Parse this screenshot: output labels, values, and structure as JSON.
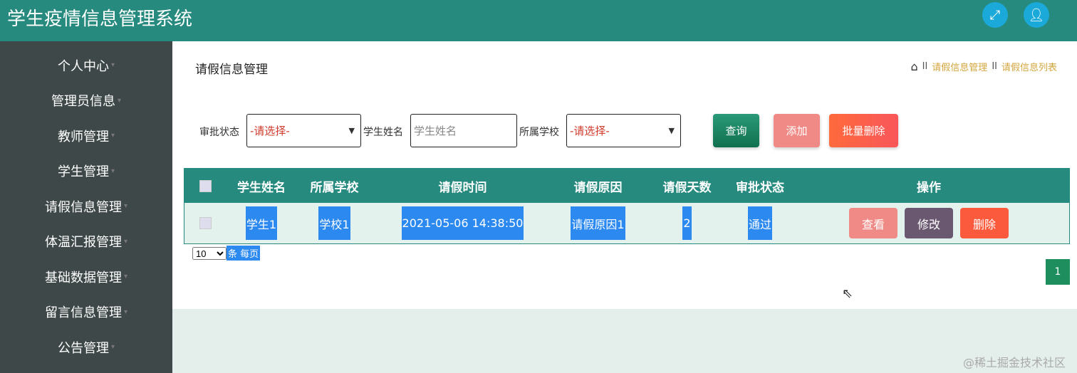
{
  "header": {
    "title": "学生疫情信息管理系统",
    "fullscreen_icon": "expand-icon",
    "user_icon": "user-icon"
  },
  "sidebar": {
    "items": [
      {
        "label": "个人中心"
      },
      {
        "label": "管理员信息"
      },
      {
        "label": "教师管理"
      },
      {
        "label": "学生管理"
      },
      {
        "label": "请假信息管理"
      },
      {
        "label": "体温汇报管理"
      },
      {
        "label": "基础数据管理"
      },
      {
        "label": "留言信息管理"
      },
      {
        "label": "公告管理"
      }
    ]
  },
  "page": {
    "title": "请假信息管理",
    "breadcrumb": [
      "请假信息管理",
      "请假信息列表"
    ],
    "sep": "II"
  },
  "filters": {
    "status_label": "审批状态",
    "status_value": "-请选择-",
    "name_label": "学生姓名",
    "name_placeholder": "学生姓名",
    "school_label": "所属学校",
    "school_value": "-请选择-"
  },
  "buttons": {
    "query": "查询",
    "add": "添加",
    "batch_delete": "批量删除"
  },
  "table": {
    "headers": [
      "学生姓名",
      "所属学校",
      "请假时间",
      "请假原因",
      "请假天数",
      "审批状态",
      "操作"
    ],
    "rows": [
      {
        "name": "学生1",
        "school": "学校1",
        "time": "2021-05-06 14:38:50",
        "reason": "请假原因1",
        "days": "2",
        "status": "通过"
      }
    ],
    "actions": {
      "view": "查看",
      "edit": "修改",
      "delete": "删除"
    }
  },
  "pagination": {
    "page_size": "10",
    "page_size_label": "条 每页",
    "current_page": "1"
  },
  "watermark": "@稀土掘金技术社区"
}
